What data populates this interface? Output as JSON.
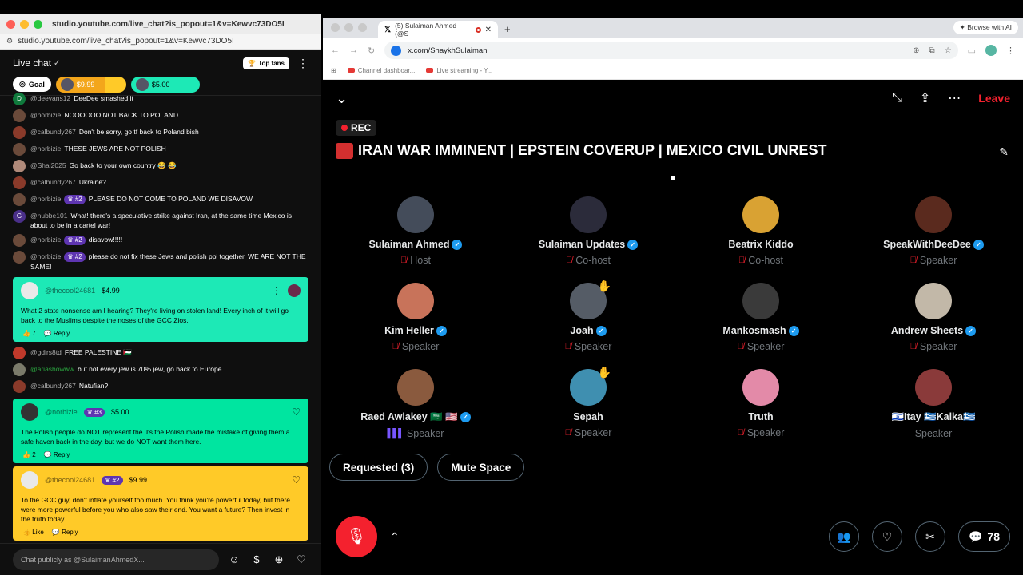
{
  "left_window": {
    "title": "studio.youtube.com/live_chat?is_popout=1&v=Kewvc73DO5I",
    "url": "studio.youtube.com/live_chat?is_popout=1&v=Kewvc73DO5I",
    "chat_title": "Live chat",
    "top_fans_label": "Top fans",
    "goal_label": "Goal",
    "tickers": [
      {
        "amount": "$9.99",
        "color": "#f3a61b"
      },
      {
        "amount": "$5.00",
        "color": "#1de9b6"
      }
    ],
    "messages": [
      {
        "name": "@deevans12",
        "text": "DeeDee smashed it",
        "badge": ""
      },
      {
        "name": "@norbizie",
        "text": "NOOOOOO NOT BACK TO POLAND",
        "badge": ""
      },
      {
        "name": "@calbundy267",
        "text": "Don't be sorry, go tf back to Poland bish",
        "badge": ""
      },
      {
        "name": "@norbizie",
        "text": "THESE JEWS ARE NOT POLISH",
        "badge": ""
      },
      {
        "name": "@Shai2025",
        "text": "Go back to your own country 😂 😂",
        "badge": ""
      },
      {
        "name": "@calbundy267",
        "text": "Ukraine?",
        "badge": ""
      },
      {
        "name": "@norbizie",
        "text": "PLEASE DO NOT COME TO POLAND WE DISAVOW",
        "badge": "#2"
      },
      {
        "name": "@nubbe101",
        "text": "What! there's a speculative strike against Iran, at the same time Mexico is about to be in a cartel war!",
        "badge": "",
        "avatar_letter": "G"
      },
      {
        "name": "@norbizie",
        "text": "disavow!!!!!",
        "badge": "#2"
      },
      {
        "name": "@norbizie",
        "text": "please do not fix these Jews and polish ppl together. WE ARE NOT THE SAME!",
        "badge": "#2"
      }
    ],
    "superchat1": {
      "name": "@thecool24681",
      "amount": "$4.99",
      "text": "What 2 state nonsense am I hearing? They're living on stolen land! Every inch of it will go back to the Muslims despite the noses of the GCC Zios.",
      "likes": "7",
      "reply": "Reply"
    },
    "messages2": [
      {
        "name": "@gdirs8td",
        "text": "FREE PALESTINE 🇵🇸"
      },
      {
        "name": "@ariashowww",
        "text": "but not every jew is 70% jew, go back to Europe"
      },
      {
        "name": "@calbundy267",
        "text": "Natufian?"
      }
    ],
    "superchat2": {
      "name": "@norbizie",
      "rank": "#3",
      "amount": "$5.00",
      "text": "The Polish people do NOT represent the J's the Polish made the mistake of giving them a safe haven back in the day. but we do NOT want them here.",
      "likes": "2",
      "reply": "Reply"
    },
    "superchat3": {
      "name": "@thecool24681",
      "rank": "#2",
      "amount": "$9.99",
      "text": "To the GCC guy, don't inflate yourself too much. You think you're powerful today, but there were more powerful before you who also saw their end. You want a future? Then invest in the truth today.",
      "like_label": "Like",
      "reply": "Reply"
    },
    "input_placeholder": "Chat publicly as @SulaimanAhmedX..."
  },
  "right_window": {
    "tab_title": "(5) Sulaiman Ahmed (@S",
    "browse_ai": "Browse with AI",
    "url": "x.com/ShaykhSulaiman",
    "bookmarks": [
      "Channel dashboar...",
      "Live streaming - Y..."
    ],
    "space": {
      "leave_label": "Leave",
      "rec_label": "REC",
      "title": "IRAN WAR IMMINENT | EPSTEIN COVERUP | MEXICO CIVIL UNREST",
      "speakers": [
        {
          "name": "Sulaiman Ahmed",
          "role": "Host",
          "verified": true,
          "muted": true,
          "hand": false,
          "avatar_color": "#444c5a"
        },
        {
          "name": "Sulaiman Updates",
          "role": "Co-host",
          "verified": true,
          "muted": true,
          "hand": false,
          "avatar_color": "#2b2b3a"
        },
        {
          "name": "Beatrix Kiddo",
          "role": "Co-host",
          "verified": false,
          "muted": true,
          "hand": false,
          "avatar_color": "#d9a233"
        },
        {
          "name": "SpeakWithDeeDee",
          "role": "Speaker",
          "verified": true,
          "muted": true,
          "hand": false,
          "avatar_color": "#5a2a1e"
        },
        {
          "name": "Kim Heller",
          "role": "Speaker",
          "verified": true,
          "muted": true,
          "hand": false,
          "avatar_color": "#c8735a"
        },
        {
          "name": "Joah",
          "role": "Speaker",
          "verified": true,
          "muted": true,
          "hand": true,
          "avatar_color": "#555c66"
        },
        {
          "name": "Mankosmash",
          "role": "Speaker",
          "verified": true,
          "muted": true,
          "hand": false,
          "avatar_color": "#3a3a3a"
        },
        {
          "name": "Andrew Sheets",
          "role": "Speaker",
          "verified": true,
          "muted": true,
          "hand": false,
          "avatar_color": "#c2b8a8"
        },
        {
          "name": "Raed Awlakey 🇸🇦 🇺🇸",
          "role": "Speaker",
          "verified": true,
          "muted": false,
          "live": true,
          "hand": false,
          "avatar_color": "#8a5a3e"
        },
        {
          "name": "Sepah",
          "role": "Speaker",
          "verified": false,
          "muted": true,
          "hand": true,
          "avatar_color": "#3f8fb0"
        },
        {
          "name": "Truth",
          "role": "Speaker",
          "verified": false,
          "muted": true,
          "hand": false,
          "avatar_color": "#e38aa8"
        },
        {
          "name": "🇮🇱Itay 🇬🇷Kalka🇬🇷",
          "role": "Speaker",
          "verified": false,
          "muted": false,
          "hand": false,
          "avatar_color": "#8a3a3a"
        }
      ],
      "requested_label": "Requested (3)",
      "mute_label": "Mute Space",
      "comment_count": "78"
    }
  },
  "colors": {
    "x_red": "#f4212e",
    "verified_blue": "#1d9bf0",
    "superchat_green": "#1de9b6",
    "superchat_yellow": "#ffca28"
  }
}
